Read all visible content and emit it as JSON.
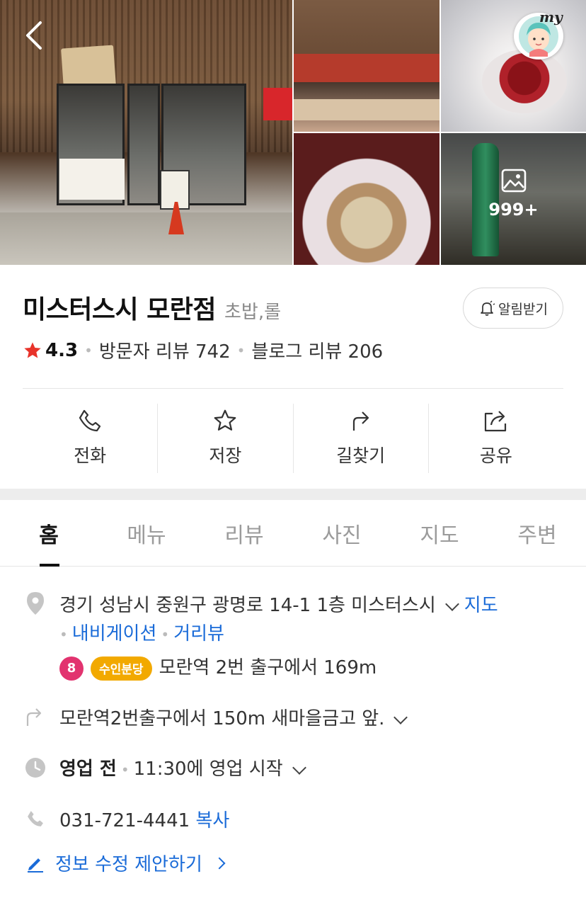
{
  "gallery": {
    "more_count": "999+"
  },
  "header": {
    "my_label": "my"
  },
  "place": {
    "name": "미스터스시 모란점",
    "category": "초밥,롤",
    "alarm_label": "알림받기",
    "rating": "4.3",
    "visitor_review": "방문자 리뷰 742",
    "blog_review": "블로그 리뷰 206"
  },
  "actions": [
    {
      "label": "전화",
      "icon": "phone-icon"
    },
    {
      "label": "저장",
      "icon": "star-icon"
    },
    {
      "label": "길찾기",
      "icon": "directions-icon"
    },
    {
      "label": "공유",
      "icon": "share-icon"
    }
  ],
  "tabs": [
    {
      "label": "홈",
      "active": true
    },
    {
      "label": "메뉴"
    },
    {
      "label": "리뷰"
    },
    {
      "label": "사진"
    },
    {
      "label": "지도"
    },
    {
      "label": "주변"
    }
  ],
  "info": {
    "address": "경기 성남시 중원구 광명로 14-1 1층 미스터스시",
    "map_link": "지도",
    "navigation_link": "내비게이션",
    "streetview_link": "거리뷰",
    "subway_line_number": "8",
    "subway_line_name": "수인분당",
    "subway_distance": "모란역 2번 출구에서 169m",
    "directions_hint": "모란역2번출구에서 150m 새마을금고 앞.",
    "hours_status": "영업 전",
    "hours_detail": "11:30에 영업 시작",
    "phone": "031-721-4441",
    "copy_label": "복사",
    "suggest_edit": "정보 수정 제안하기"
  },
  "colors": {
    "accent_blue": "#1a6bd8",
    "star_red": "#e8332a",
    "line8_pink": "#e2336f",
    "suin_bundang_yellow": "#f2a900"
  }
}
